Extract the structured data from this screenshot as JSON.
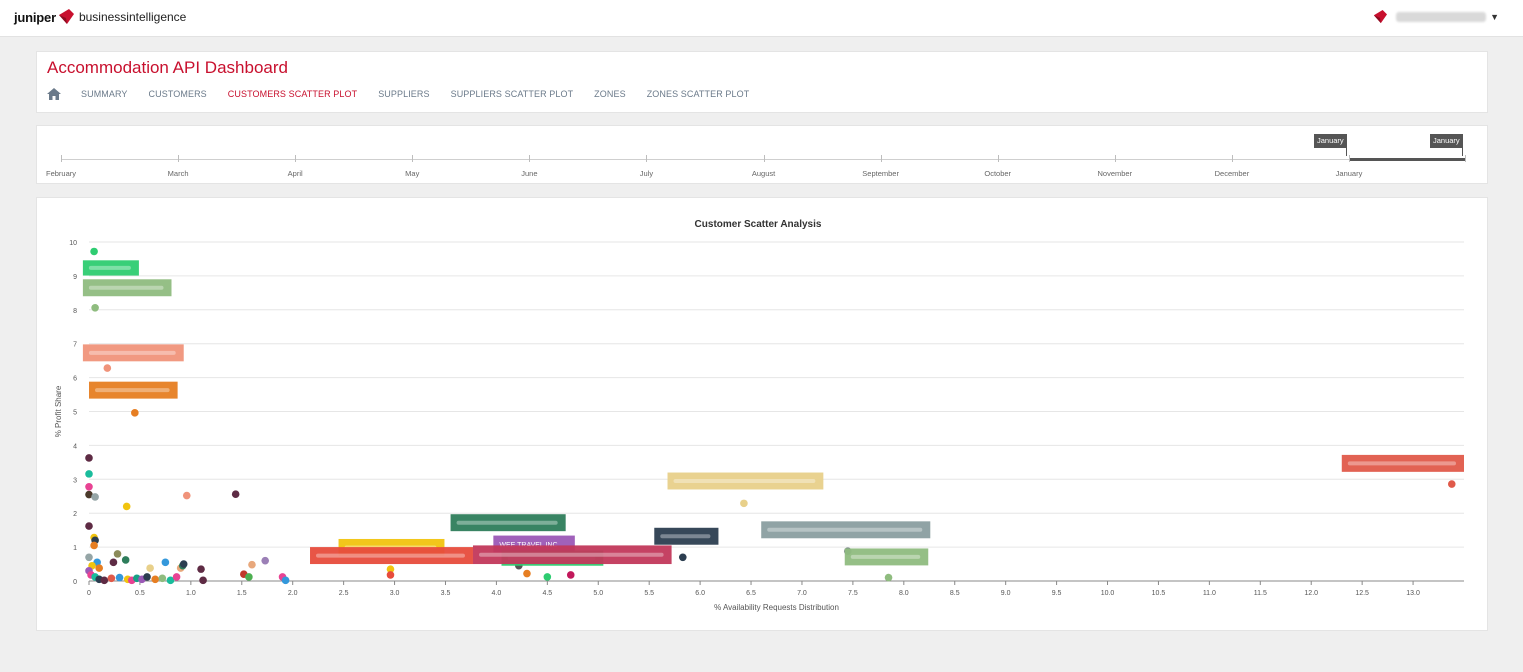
{
  "header": {
    "brand": "juniper",
    "product": "businessintelligence",
    "brand_color": "#c8102e"
  },
  "dashboard": {
    "title": "Accommodation API Dashboard",
    "home_icon": "home-icon",
    "tabs": [
      {
        "label": "SUMMARY",
        "active": false
      },
      {
        "label": "CUSTOMERS",
        "active": false
      },
      {
        "label": "CUSTOMERS SCATTER PLOT",
        "active": true
      },
      {
        "label": "SUPPLIERS",
        "active": false
      },
      {
        "label": "SUPPLIERS SCATTER PLOT",
        "active": false
      },
      {
        "label": "ZONES",
        "active": false
      },
      {
        "label": "ZONES SCATTER PLOT",
        "active": false
      }
    ]
  },
  "timeline": {
    "months": [
      "February",
      "March",
      "April",
      "May",
      "June",
      "July",
      "August",
      "September",
      "October",
      "November",
      "December",
      "January"
    ],
    "handle_left": "January",
    "handle_right": "January"
  },
  "chart_data": {
    "type": "scatter",
    "title": "Customer Scatter Analysis",
    "xlabel": "% Availability Requests Distribution",
    "ylabel": "% Profit Share",
    "xlim": [
      0,
      13.5
    ],
    "ylim": [
      0,
      10
    ],
    "xticks": [
      "0",
      "0.5",
      "1.0",
      "1.5",
      "2.0",
      "2.5",
      "3.0",
      "3.5",
      "4.0",
      "4.5",
      "5.0",
      "5.5",
      "6.0",
      "6.5",
      "7.0",
      "7.5",
      "8.0",
      "8.5",
      "9.0",
      "9.5",
      "10.0",
      "10.5",
      "11.0",
      "11.5",
      "12.0",
      "12.5",
      "13.0"
    ],
    "yticks": [
      "0",
      "1",
      "2",
      "3",
      "4",
      "5",
      "6",
      "7",
      "8",
      "9",
      "10"
    ],
    "grid": true,
    "points": [
      {
        "x": 0.05,
        "y": 9.72,
        "color": "#2ecc71"
      },
      {
        "x": 0.06,
        "y": 8.06,
        "color": "#8fbc7f"
      },
      {
        "x": 0.18,
        "y": 6.28,
        "color": "#f0937a"
      },
      {
        "x": 0.45,
        "y": 4.96,
        "color": "#e67e22"
      },
      {
        "x": 13.38,
        "y": 2.86,
        "color": "#e05a4a"
      },
      {
        "x": 6.43,
        "y": 2.29,
        "color": "#e8d08a"
      },
      {
        "x": 0.0,
        "y": 3.63,
        "color": "#5e2b44"
      },
      {
        "x": 0.0,
        "y": 3.16,
        "color": "#1abc9c"
      },
      {
        "x": 0.0,
        "y": 2.78,
        "color": "#e84393"
      },
      {
        "x": 0.0,
        "y": 2.55,
        "color": "#4b3a2a"
      },
      {
        "x": 0.06,
        "y": 2.48,
        "color": "#95a5a6"
      },
      {
        "x": 0.37,
        "y": 2.2,
        "color": "#f1c40f"
      },
      {
        "x": 0.96,
        "y": 2.52,
        "color": "#f0937a"
      },
      {
        "x": 1.44,
        "y": 2.56,
        "color": "#5e2b44"
      },
      {
        "x": 0.0,
        "y": 1.62,
        "color": "#5e2b44"
      },
      {
        "x": 0.05,
        "y": 1.28,
        "color": "#f1c40f"
      },
      {
        "x": 0.06,
        "y": 1.2,
        "color": "#2c3e50"
      },
      {
        "x": 0.05,
        "y": 1.05,
        "color": "#e67e22"
      },
      {
        "x": 0.0,
        "y": 0.7,
        "color": "#95a5a6"
      },
      {
        "x": 0.08,
        "y": 0.55,
        "color": "#3498db"
      },
      {
        "x": 0.03,
        "y": 0.45,
        "color": "#f1c40f"
      },
      {
        "x": 0.1,
        "y": 0.38,
        "color": "#e67e22"
      },
      {
        "x": 0.0,
        "y": 0.3,
        "color": "#9b59b6"
      },
      {
        "x": 0.02,
        "y": 0.18,
        "color": "#e84393"
      },
      {
        "x": 0.06,
        "y": 0.12,
        "color": "#1abc9c"
      },
      {
        "x": 0.1,
        "y": 0.05,
        "color": "#2c3e50"
      },
      {
        "x": 0.15,
        "y": 0.02,
        "color": "#5e2b44"
      },
      {
        "x": 0.22,
        "y": 0.08,
        "color": "#e05a4a"
      },
      {
        "x": 0.24,
        "y": 0.55,
        "color": "#5e2b44"
      },
      {
        "x": 0.28,
        "y": 0.8,
        "color": "#8b8b5a"
      },
      {
        "x": 0.3,
        "y": 0.1,
        "color": "#3498db"
      },
      {
        "x": 0.36,
        "y": 0.62,
        "color": "#2e7d5b"
      },
      {
        "x": 0.38,
        "y": 0.05,
        "color": "#f1c40f"
      },
      {
        "x": 0.42,
        "y": 0.02,
        "color": "#e84393"
      },
      {
        "x": 0.47,
        "y": 0.08,
        "color": "#16a085"
      },
      {
        "x": 0.52,
        "y": 0.05,
        "color": "#9b59b6"
      },
      {
        "x": 0.57,
        "y": 0.12,
        "color": "#2c3e50"
      },
      {
        "x": 0.6,
        "y": 0.38,
        "color": "#e8d08a"
      },
      {
        "x": 0.65,
        "y": 0.05,
        "color": "#e67e22"
      },
      {
        "x": 0.72,
        "y": 0.08,
        "color": "#8fbc7f"
      },
      {
        "x": 0.75,
        "y": 0.55,
        "color": "#3498db"
      },
      {
        "x": 0.8,
        "y": 0.02,
        "color": "#1abc9c"
      },
      {
        "x": 0.86,
        "y": 0.12,
        "color": "#e84393"
      },
      {
        "x": 0.9,
        "y": 0.38,
        "color": "#e8a87c"
      },
      {
        "x": 0.92,
        "y": 0.45,
        "color": "#2e7d5b"
      },
      {
        "x": 0.93,
        "y": 0.5,
        "color": "#2c3e50"
      },
      {
        "x": 1.1,
        "y": 0.35,
        "color": "#5e2b44"
      },
      {
        "x": 1.12,
        "y": 0.02,
        "color": "#5e2b44"
      },
      {
        "x": 1.52,
        "y": 0.2,
        "color": "#c0392b"
      },
      {
        "x": 1.57,
        "y": 0.12,
        "color": "#4caf50"
      },
      {
        "x": 1.6,
        "y": 0.48,
        "color": "#e8a87c"
      },
      {
        "x": 1.73,
        "y": 0.6,
        "color": "#9b7fb6"
      },
      {
        "x": 1.9,
        "y": 0.12,
        "color": "#e84393"
      },
      {
        "x": 1.93,
        "y": 0.02,
        "color": "#3498db"
      },
      {
        "x": 2.96,
        "y": 0.35,
        "color": "#f1c40f"
      },
      {
        "x": 2.96,
        "y": 0.18,
        "color": "#e74c3c"
      },
      {
        "x": 4.22,
        "y": 0.45,
        "color": "#555555"
      },
      {
        "x": 4.3,
        "y": 0.22,
        "color": "#e67e22"
      },
      {
        "x": 4.5,
        "y": 0.12,
        "color": "#2ecc71"
      },
      {
        "x": 4.73,
        "y": 0.18,
        "color": "#c2185b"
      },
      {
        "x": 5.83,
        "y": 0.7,
        "color": "#2c3e50"
      },
      {
        "x": 7.45,
        "y": 0.88,
        "color": "#7f8c8d"
      },
      {
        "x": 7.85,
        "y": 0.1,
        "color": "#8fbc7f"
      }
    ],
    "tooltips": [
      {
        "x": -0.06,
        "y": 9.46,
        "w": 0.55,
        "h": 0.45,
        "color": "#2ecc71",
        "text": ""
      },
      {
        "x": -0.06,
        "y": 8.9,
        "w": 0.87,
        "h": 0.5,
        "color": "#8fbc7f",
        "text": ""
      },
      {
        "x": -0.06,
        "y": 6.98,
        "w": 0.99,
        "h": 0.5,
        "color": "#f0937a",
        "text": ""
      },
      {
        "x": 0.0,
        "y": 5.88,
        "w": 0.87,
        "h": 0.5,
        "color": "#e67e22",
        "text": ""
      },
      {
        "x": 12.3,
        "y": 3.72,
        "w": 1.2,
        "h": 0.5,
        "color": "#e05a4a",
        "text": ""
      },
      {
        "x": 5.68,
        "y": 3.2,
        "w": 1.53,
        "h": 0.5,
        "color": "#e8d08a",
        "text": ""
      },
      {
        "x": 3.55,
        "y": 1.97,
        "w": 1.13,
        "h": 0.5,
        "color": "#2e7d5b",
        "text": ""
      },
      {
        "x": 5.55,
        "y": 1.57,
        "w": 0.63,
        "h": 0.5,
        "color": "#2c3e50",
        "text": ""
      },
      {
        "x": 6.6,
        "y": 1.76,
        "w": 1.66,
        "h": 0.5,
        "color": "#8a9ea0",
        "text": ""
      },
      {
        "x": 7.42,
        "y": 0.96,
        "w": 0.82,
        "h": 0.5,
        "color": "#8fbc7f",
        "text": ""
      },
      {
        "x": 3.97,
        "y": 1.34,
        "w": 0.8,
        "h": 0.5,
        "color": "#9b59b6",
        "text": "WEE TRAVEL INC"
      },
      {
        "x": 2.45,
        "y": 1.24,
        "w": 1.04,
        "h": 0.5,
        "color": "#f1c40f",
        "text": ""
      },
      {
        "x": 4.05,
        "y": 0.9,
        "w": 1.0,
        "h": 0.45,
        "color": "#2ecc71",
        "text": ""
      },
      {
        "x": 2.17,
        "y": 1.0,
        "w": 1.6,
        "h": 0.5,
        "color": "#e74c3c",
        "text": ""
      },
      {
        "x": 3.77,
        "y": 1.05,
        "w": 1.95,
        "h": 0.55,
        "color": "#c2385b",
        "text": ""
      }
    ]
  }
}
